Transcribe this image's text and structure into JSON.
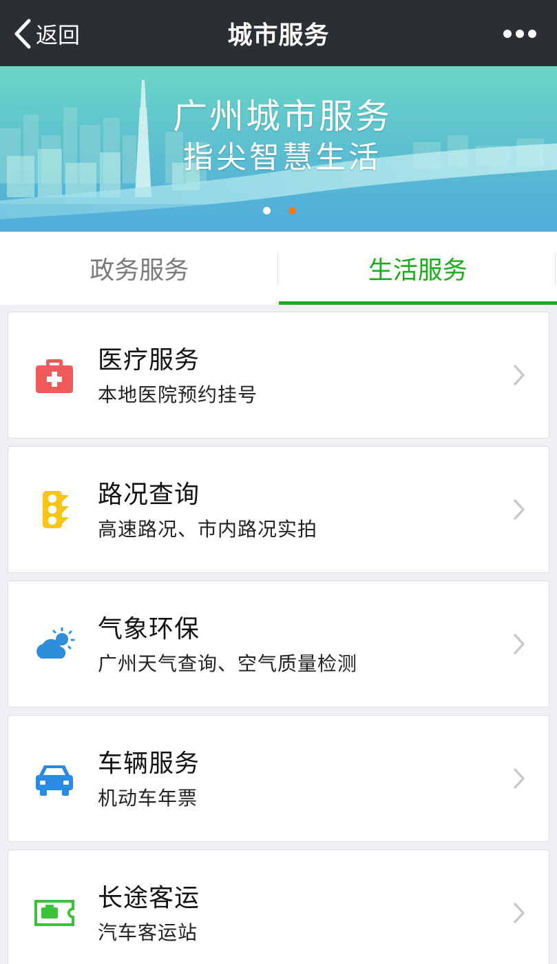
{
  "nav": {
    "back_label": "返回",
    "title": "城市服务"
  },
  "banner": {
    "line1": "广州城市服务",
    "line2": "指尖智慧生活",
    "slides": 2,
    "active_slide": 2
  },
  "tabs": [
    {
      "label": "政务服务",
      "active": false
    },
    {
      "label": "生活服务",
      "active": true
    }
  ],
  "services": [
    {
      "title": "医疗服务",
      "subtitle": "本地医院预约挂号",
      "icon": "medical-kit-icon"
    },
    {
      "title": "路况查询",
      "subtitle": "高速路况、市内路况实拍",
      "icon": "traffic-light-icon"
    },
    {
      "title": "气象环保",
      "subtitle": "广州天气查询、空气质量检测",
      "icon": "weather-cloud-sun-icon"
    },
    {
      "title": "车辆服务",
      "subtitle": "机动车年票",
      "icon": "car-icon"
    },
    {
      "title": "长途客运",
      "subtitle": "汽车客运站",
      "icon": "bus-ticket-icon"
    }
  ],
  "colors": {
    "navbar_bg": "#2b2f33",
    "accent_green": "#1aad19",
    "medical_red": "#f05a5a",
    "traffic_yellow": "#f5c518",
    "weather_blue": "#2e8fd8",
    "car_blue": "#2a8ce0",
    "ticket_green": "#3cc13a",
    "dot_active": "#f07a20"
  }
}
